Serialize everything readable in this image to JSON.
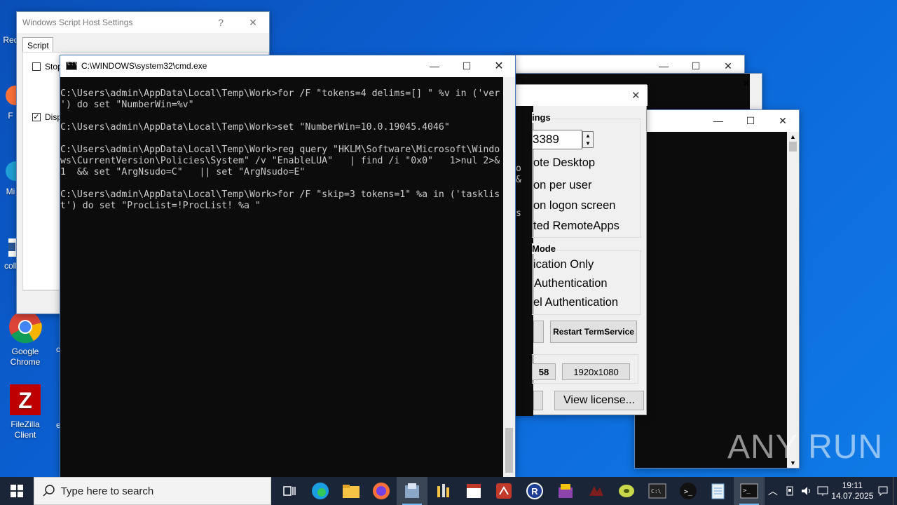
{
  "desktop": {
    "icons": [
      {
        "label": "Rec",
        "name": "recycle-bin"
      },
      {
        "label": "F",
        "name": "firefox"
      },
      {
        "label": "Mi",
        "name": "edge"
      },
      {
        "label": "coll",
        "name": "word-doc"
      },
      {
        "label": "Google Chrome",
        "name": "chrome"
      },
      {
        "label": "FileZilla Client",
        "name": "filezilla"
      },
      {
        "label": "c",
        "name": "partial-icon-c"
      },
      {
        "label": "e",
        "name": "partial-icon-e"
      }
    ]
  },
  "wsh_window": {
    "title": "Windows Script Host Settings",
    "help": "?",
    "close": "✕",
    "tab": "Script",
    "options": [
      {
        "label": "Stop",
        "checked": false
      },
      {
        "label": "Disp",
        "checked": true
      }
    ]
  },
  "cmd_window": {
    "title": "C:\\WINDOWS\\system32\\cmd.exe",
    "minimize": "—",
    "maximize": "☐",
    "close": "✕",
    "lines": [
      "C:\\Users\\admin\\AppData\\Local\\Temp\\Work>for /F \"tokens=4 delims=[] \" %v in ('ver",
      "') do set \"NumberWin=%v\"",
      "",
      "C:\\Users\\admin\\AppData\\Local\\Temp\\Work>set \"NumberWin=10.0.19045.4046\"",
      "",
      "C:\\Users\\admin\\AppData\\Local\\Temp\\Work>reg query \"HKLM\\Software\\Microsoft\\Windo",
      "ws\\CurrentVersion\\Policies\\System\" /v \"EnableLUA\"   | find /i \"0x0\"   1>nul 2>&",
      "1  && set \"ArgNsudo=C\"   || set \"ArgNsudo=E\"",
      "",
      "C:\\Users\\admin\\AppData\\Local\\Temp\\Work>for /F \"skip=3 tokens=1\" %a in ('tasklis",
      "t') do set \"ProcList=!ProcList! %a \""
    ]
  },
  "back_cmd_windows": {
    "minimize": "—",
    "maximize": "☐",
    "close": "✕",
    "side_chars": [
      "o",
      "&",
      "s"
    ]
  },
  "rdp_window": {
    "close": "✕",
    "group1_title": "ings",
    "port_value": "3389",
    "opt1": "ote Desktop",
    "opt2": "on per user",
    "opt3": "on logon screen",
    "opt4": "ted RemoteApps",
    "group2_title": "Mode",
    "mode1": "ication Only",
    "mode2": "Authentication",
    "mode3": "el Authentication",
    "restart_btn": "Restart TermService",
    "res1": "58",
    "res2": "1920x1080",
    "license_btn": "View license..."
  },
  "watermark": "ANY RUN",
  "taskbar": {
    "search_placeholder": "Type here to search",
    "time": "19:11",
    "date": "14.07.2025"
  }
}
